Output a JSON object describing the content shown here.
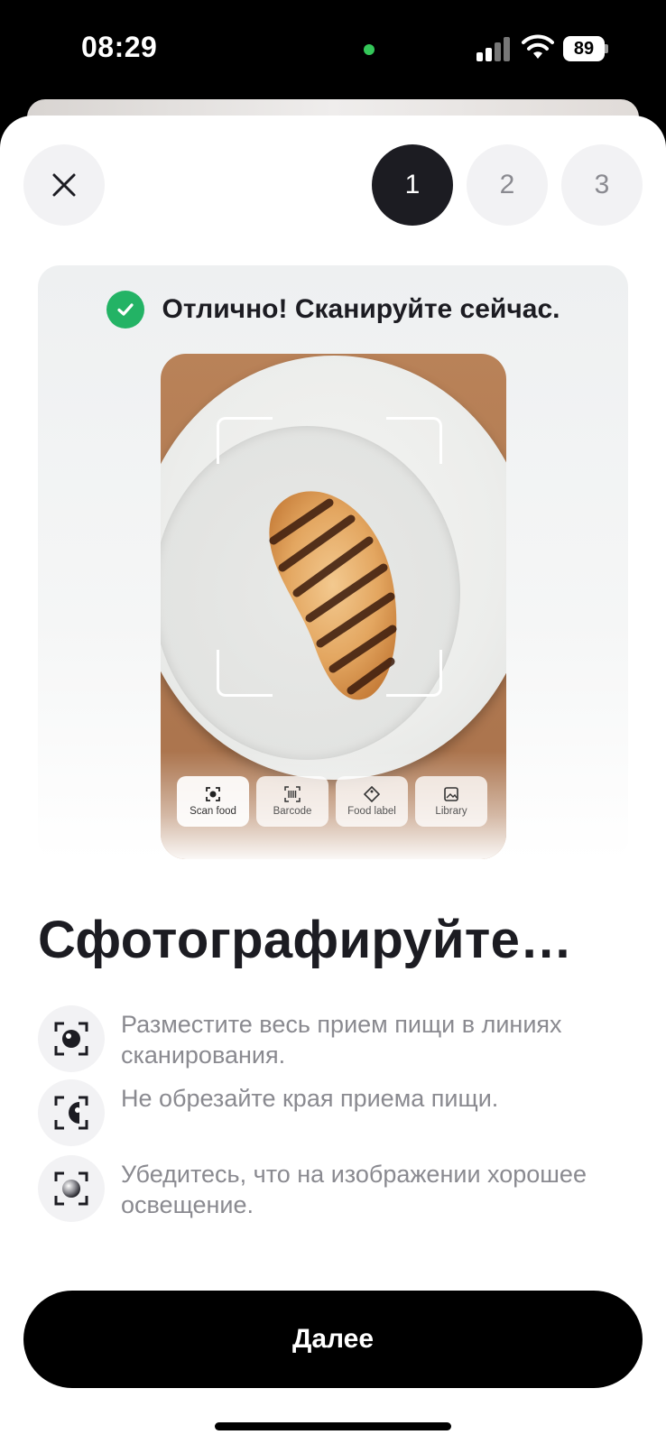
{
  "status_bar": {
    "time": "08:29",
    "battery": "89",
    "icons": [
      "signal-icon",
      "wifi-icon",
      "battery-icon"
    ]
  },
  "header": {
    "close_icon": "close-icon",
    "steps": [
      "1",
      "2",
      "3"
    ],
    "active_step": 1
  },
  "preview": {
    "status_text": "Отлично! Сканируйте сейчас.",
    "status_icon": "check-circle-icon",
    "modes": [
      {
        "label": "Scan food",
        "icon": "scan-icon"
      },
      {
        "label": "Barcode",
        "icon": "barcode-icon"
      },
      {
        "label": "Food label",
        "icon": "tag-icon"
      },
      {
        "label": "Library",
        "icon": "image-icon"
      }
    ]
  },
  "content": {
    "title": "Сфотографируйте…",
    "tips": [
      {
        "text": "Разместите весь прием пищи в линиях сканирования.",
        "icon": "scan-frame-icon"
      },
      {
        "text": "Не обрезайте края приема пищи.",
        "icon": "crop-edge-icon"
      },
      {
        "text": "Убедитесь, что на изображении хорошее освещение.",
        "icon": "lighting-icon"
      }
    ]
  },
  "footer": {
    "next_label": "Далее"
  },
  "colors": {
    "accent": "#1c1c22",
    "success": "#23b365",
    "muted_text": "#8a8a90",
    "button": "#000000"
  }
}
